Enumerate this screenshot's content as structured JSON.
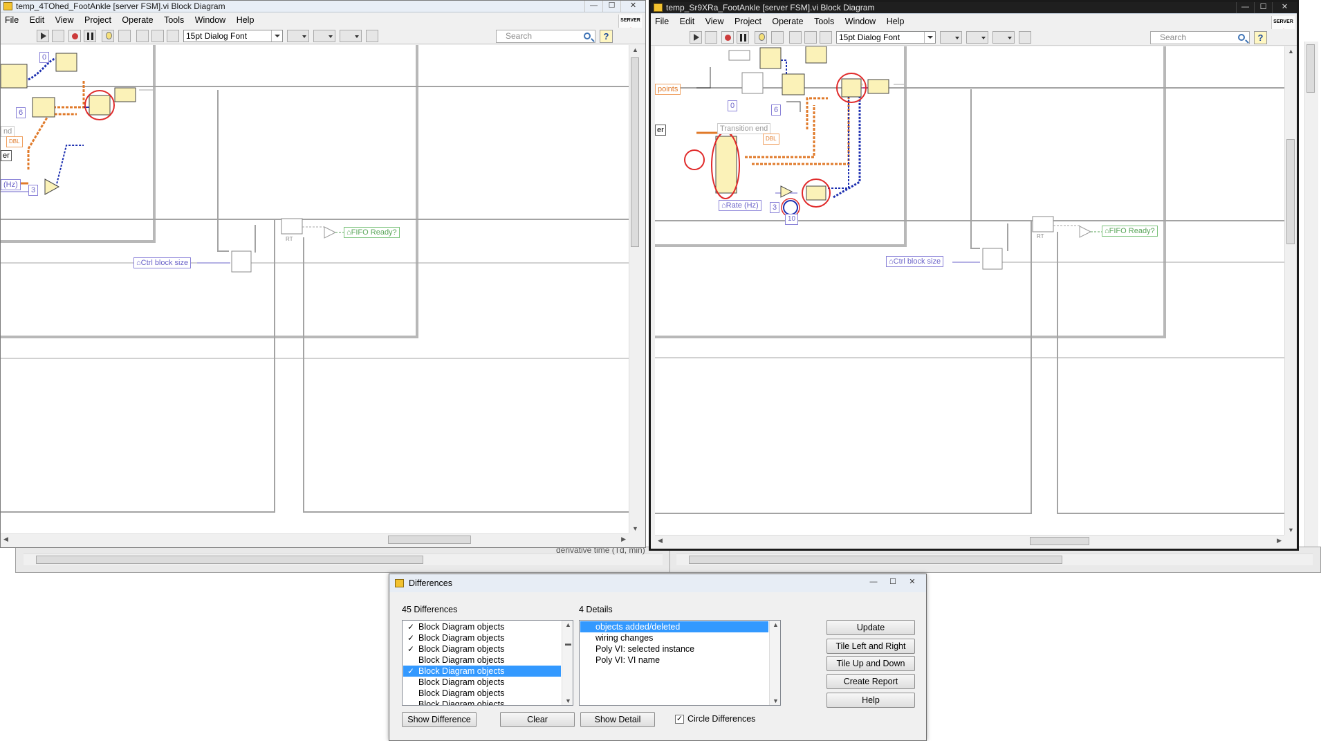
{
  "left_window": {
    "title": "temp_4TOhed_FootAnkle [server FSM].vi Block Diagram",
    "server_label": "SERVER",
    "font_selector": "15pt Dialog Font",
    "search_placeholder": "Search",
    "help_label": "?"
  },
  "right_window": {
    "title": "temp_Sr9XRa_FootAnkle [server FSM].vi Block Diagram",
    "server_label": "SERVER",
    "font_selector": "15pt Dialog Font",
    "search_placeholder": "Search",
    "help_label": "?"
  },
  "menu": [
    "File",
    "Edit",
    "View",
    "Project",
    "Operate",
    "Tools",
    "Window",
    "Help"
  ],
  "window_buttons": {
    "minimize": "—",
    "maximize": "☐",
    "close": "✕"
  },
  "diagram_left": {
    "zero_const": "0",
    "six_const": "6",
    "three_const": "3",
    "partial_end": "nd",
    "partial_er": "er",
    "partial_hz": "(Hz)",
    "dbl_label": "DBL",
    "ctrl_block_size": "Ctrl block size",
    "fifo_ready": "FIFO Ready?",
    "rt_label": "RT"
  },
  "diagram_right": {
    "points_label": "points",
    "six_const": "6",
    "zero_const": "0",
    "transition_end": "Transition end",
    "partial_er": "er",
    "rate_hz": "Rate (Hz)",
    "three_const": "3",
    "ten_const": "10",
    "dbl_label": "DBL",
    "ctrl_block_size": "Ctrl block size",
    "fifo_ready": "FIFO Ready?",
    "rt_label": "RT"
  },
  "behind_window": {
    "derivative_text": "derivative time (Td, min)"
  },
  "differences_dialog": {
    "title": "Differences",
    "diff_count_label": "45 Differences",
    "details_count_label": "4 Details",
    "differences": [
      {
        "label": "Block Diagram objects",
        "checked": true,
        "selected": false
      },
      {
        "label": "Block Diagram objects",
        "checked": true,
        "selected": false
      },
      {
        "label": "Block Diagram objects",
        "checked": true,
        "selected": false
      },
      {
        "label": "Block Diagram objects",
        "checked": false,
        "selected": false
      },
      {
        "label": "Block Diagram objects",
        "checked": true,
        "selected": true
      },
      {
        "label": "Block Diagram objects",
        "checked": false,
        "selected": false
      },
      {
        "label": "Block Diagram objects",
        "checked": false,
        "selected": false
      },
      {
        "label": "Block Diagram objects",
        "checked": false,
        "selected": false
      }
    ],
    "details": [
      {
        "label": "objects added/deleted",
        "selected": true
      },
      {
        "label": "wiring changes",
        "selected": false
      },
      {
        "label": "Poly VI: selected instance",
        "selected": false
      },
      {
        "label": "Poly VI: VI name",
        "selected": false
      }
    ],
    "buttons": {
      "update": "Update",
      "tile_left_right": "Tile Left and Right",
      "tile_up_down": "Tile Up and Down",
      "create_report": "Create Report",
      "help": "Help",
      "show_difference": "Show Difference",
      "clear": "Clear",
      "show_detail": "Show Detail"
    },
    "circle_differences_label": "Circle Differences",
    "circle_differences_checked": true,
    "checkmark": "✓"
  },
  "colors": {
    "wire_orange": "#e07a2a",
    "wire_blue": "#1c2fb0",
    "cluster_pink": "#b94a8c",
    "struct_gray": "#a3a3a3",
    "circle_red": "#e02a2a",
    "control_purple": "#6a62c8",
    "indicator_green": "#5aa65a",
    "selection_blue": "#3399ff"
  }
}
